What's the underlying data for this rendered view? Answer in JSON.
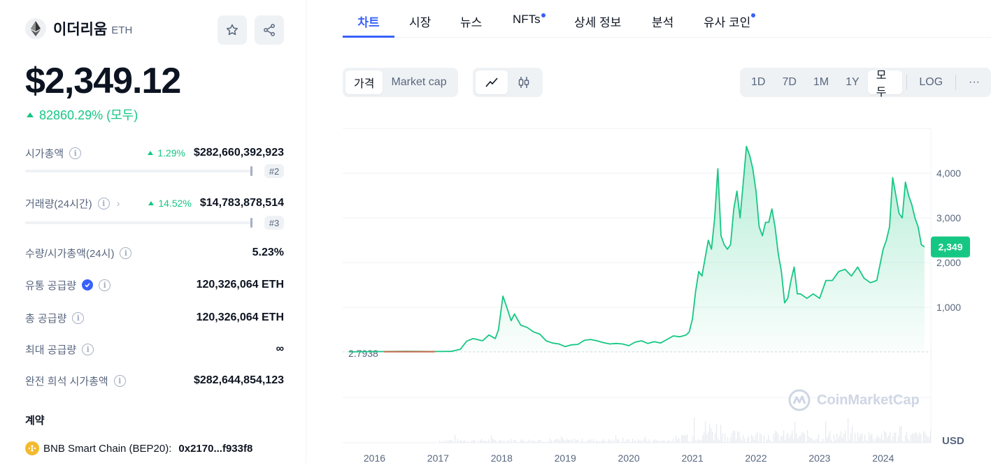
{
  "coin": {
    "name": "이더리움",
    "symbol": "ETH",
    "price": "$2,349.12",
    "change_all": "82860.29% (모두)"
  },
  "stats": {
    "market_cap": {
      "label": "시가총액",
      "pct": "1.29%",
      "value": "$282,660,392,923",
      "rank": "#2"
    },
    "volume": {
      "label": "거래량(24시간)",
      "pct": "14.52%",
      "value": "$14,783,878,514",
      "rank": "#3"
    },
    "vol_mcap": {
      "label": "수량/시가총액(24시)",
      "value": "5.23%"
    },
    "circulating": {
      "label": "유통 공급량",
      "value": "120,326,064 ETH"
    },
    "total": {
      "label": "총 공급량",
      "value": "120,326,064 ETH"
    },
    "max": {
      "label": "최대 공급량",
      "value": "∞"
    },
    "fdv": {
      "label": "완전 희석 시가총액",
      "value": "$282,644,854,123"
    }
  },
  "contracts": {
    "title": "계약",
    "items": [
      {
        "chain": "BNB Smart Chain (BEP20):",
        "address": "0x2170...f933f8"
      }
    ]
  },
  "tabs": [
    "차트",
    "시장",
    "뉴스",
    "NFTs",
    "상세 정보",
    "분석",
    "유사 코인"
  ],
  "toolbar": {
    "price": "가격",
    "market_cap": "Market cap",
    "ranges": [
      "1D",
      "7D",
      "1M",
      "1Y",
      "모두"
    ],
    "log": "LOG",
    "more": "···"
  },
  "colors": {
    "accent": "#3861fb",
    "up": "#16c784",
    "line": "#16c784",
    "early_line": "#c06848"
  },
  "chart_data": {
    "type": "area",
    "x_ticks": [
      "2016",
      "2017",
      "2018",
      "2019",
      "2020",
      "2021",
      "2022",
      "2023",
      "2024"
    ],
    "y_ticks": [
      "1,000",
      "2,000",
      "3,000",
      "4,000"
    ],
    "y_unit": "USD",
    "ylim": [
      0,
      5000
    ],
    "baseline_label": "2.7938",
    "current_label": "2,349",
    "watermark": "CoinMarketCap",
    "series": [
      {
        "x": [
          2015.6,
          2016.0,
          2016.5,
          2016.9,
          2017.2,
          2017.35,
          2017.45,
          2017.55,
          2017.7,
          2017.8,
          2017.9,
          2017.95,
          2018.02,
          2018.08,
          2018.15,
          2018.2,
          2018.3,
          2018.4,
          2018.5,
          2018.6,
          2018.7,
          2018.8,
          2018.9,
          2019.0,
          2019.1,
          2019.2,
          2019.3,
          2019.4,
          2019.5,
          2019.6,
          2019.7,
          2019.8,
          2019.9,
          2020.0,
          2020.1,
          2020.2,
          2020.3,
          2020.4,
          2020.5,
          2020.6,
          2020.7,
          2020.8,
          2020.9,
          2020.95,
          2021.0,
          2021.05,
          2021.1,
          2021.15,
          2021.2,
          2021.25,
          2021.3,
          2021.35,
          2021.4,
          2021.45,
          2021.5,
          2021.55,
          2021.6,
          2021.65,
          2021.7,
          2021.75,
          2021.8,
          2021.85,
          2021.9,
          2021.95,
          2022.0,
          2022.05,
          2022.1,
          2022.15,
          2022.2,
          2022.25,
          2022.3,
          2022.35,
          2022.4,
          2022.45,
          2022.5,
          2022.55,
          2022.6,
          2022.65,
          2022.7,
          2022.8,
          2022.9,
          2023.0,
          2023.1,
          2023.2,
          2023.3,
          2023.4,
          2023.5,
          2023.6,
          2023.7,
          2023.8,
          2023.9,
          2024.0,
          2024.05,
          2024.1,
          2024.15,
          2024.2,
          2024.25,
          2024.3,
          2024.35,
          2024.4,
          2024.45,
          2024.5,
          2024.55,
          2024.6,
          2024.65
        ],
        "y": [
          2.8,
          8,
          12,
          9,
          12,
          60,
          240,
          300,
          250,
          380,
          300,
          500,
          1250,
          1000,
          700,
          850,
          600,
          550,
          450,
          400,
          250,
          200,
          180,
          120,
          160,
          170,
          260,
          280,
          250,
          210,
          180,
          190,
          180,
          140,
          220,
          250,
          190,
          230,
          200,
          280,
          360,
          340,
          380,
          450,
          740,
          1350,
          1800,
          1700,
          2100,
          2500,
          2300,
          3000,
          4100,
          2600,
          2400,
          2300,
          2400,
          3200,
          3600,
          3000,
          3800,
          4600,
          4400,
          4100,
          3600,
          2800,
          2600,
          2900,
          2900,
          3200,
          2800,
          2200,
          1800,
          1100,
          1200,
          1600,
          1900,
          1300,
          1300,
          1200,
          1300,
          1200,
          1600,
          1600,
          1800,
          1850,
          1700,
          1900,
          1650,
          1550,
          1600,
          2300,
          2500,
          2800,
          3900,
          3500,
          3100,
          3000,
          3800,
          3500,
          3300,
          3000,
          2800,
          2400,
          2349
        ]
      }
    ]
  }
}
